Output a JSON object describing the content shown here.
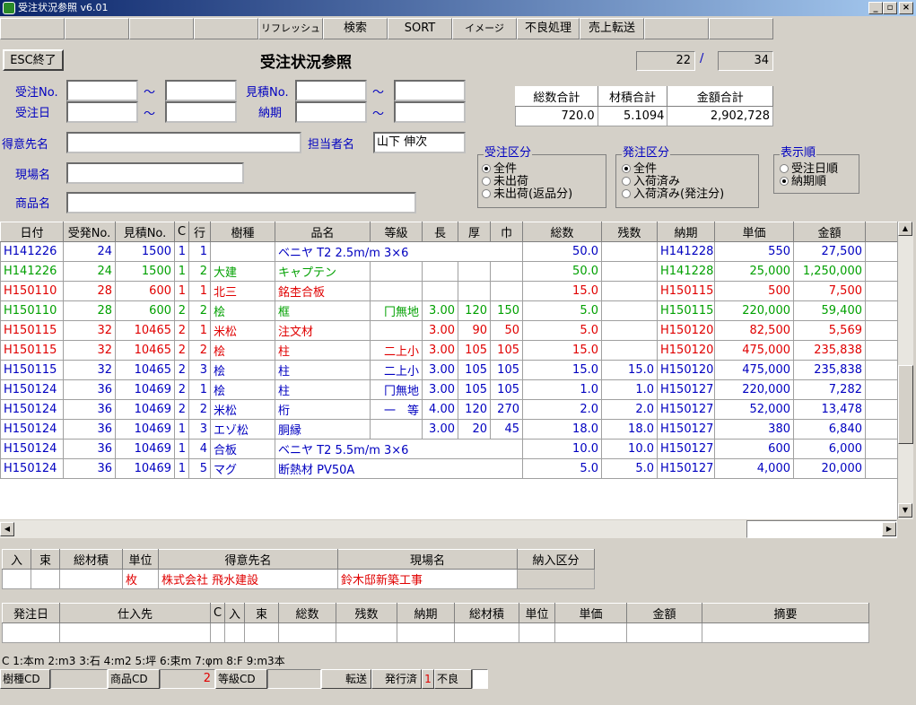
{
  "window": {
    "title": "受注状況参照 v6.01",
    "min": "_",
    "max": "▫",
    "close": "×"
  },
  "toolbar": {
    "buttons": [
      "リフレッシュ",
      "検索",
      "SORT",
      "イメージ",
      "不良処理",
      "売上転送"
    ]
  },
  "header": {
    "esc_label": "ESC終了",
    "page_title": "受注状況参照",
    "current": "22",
    "separator": "/",
    "total": "34"
  },
  "search": {
    "juchu_no_label": "受注No.",
    "juchu_bi_label": "受注日",
    "mitsumori_label": "見積No.",
    "nouki_label": "納期",
    "tilde": "～",
    "tokuisaki_label": "得意先名",
    "genba_label": "現場名",
    "shohin_label": "商品名",
    "tanto_label": "担当者名",
    "tanto_value": "山下 伸次"
  },
  "totals": {
    "headers": [
      "総数合計",
      "材積合計",
      "金額合計"
    ],
    "values": [
      "720.0",
      "5.1094",
      "2,902,728"
    ]
  },
  "juchu_kubun": {
    "legend": "受注区分",
    "options": [
      "全件",
      "未出荷",
      "未出荷(返品分)"
    ],
    "selected": 0
  },
  "hatchu_kubun": {
    "legend": "発注区分",
    "options": [
      "全件",
      "入荷済み",
      "入荷済み(発注分)"
    ],
    "selected": 0
  },
  "hyoji_jun": {
    "legend": "表示順",
    "options": [
      "受注日順",
      "納期順"
    ],
    "selected": 1
  },
  "grid": {
    "headers": [
      "日付",
      "受発No.",
      "見積No.",
      "C",
      "行",
      "樹種",
      "品名",
      "等級",
      "長",
      "厚",
      "巾",
      "総数",
      "残数",
      "納期",
      "単価",
      "金額"
    ],
    "rows": [
      {
        "color": "blu",
        "cells": [
          "H141226",
          "24",
          "1500",
          "1",
          "1",
          "",
          "ベニヤ T2 2.5m/m 3×6",
          "",
          "",
          "",
          "",
          "50.0",
          "",
          "H141228",
          "550",
          "27,500"
        ],
        "span": true
      },
      {
        "color": "grn",
        "cells": [
          "H141226",
          "24",
          "1500",
          "1",
          "2",
          "大建",
          "キャプテン",
          "",
          "",
          "",
          "",
          "50.0",
          "",
          "H141228",
          "25,000",
          "1,250,000"
        ]
      },
      {
        "color": "red",
        "cells": [
          "H150110",
          "28",
          "600",
          "1",
          "1",
          "北三",
          "銘杢合板",
          "",
          "",
          "",
          "",
          "15.0",
          "",
          "H150115",
          "500",
          "7,500"
        ]
      },
      {
        "color": "grn",
        "cells": [
          "H150110",
          "28",
          "600",
          "2",
          "2",
          "桧",
          "框",
          "冂無地",
          "3.00",
          "120",
          "150",
          "5.0",
          "",
          "H150115",
          "220,000",
          "59,400"
        ]
      },
      {
        "color": "red",
        "cells": [
          "H150115",
          "32",
          "10465",
          "2",
          "1",
          "米松",
          "注文材",
          "",
          "3.00",
          "90",
          "50",
          "5.0",
          "",
          "H150120",
          "82,500",
          "5,569"
        ]
      },
      {
        "color": "red",
        "cells": [
          "H150115",
          "32",
          "10465",
          "2",
          "2",
          "桧",
          "柱",
          "二上小",
          "3.00",
          "105",
          "105",
          "15.0",
          "",
          "H150120",
          "475,000",
          "235,838"
        ]
      },
      {
        "color": "blu",
        "cells": [
          "H150115",
          "32",
          "10465",
          "2",
          "3",
          "桧",
          "柱",
          "二上小",
          "3.00",
          "105",
          "105",
          "15.0",
          "15.0",
          "H150120",
          "475,000",
          "235,838"
        ]
      },
      {
        "color": "blu",
        "cells": [
          "H150124",
          "36",
          "10469",
          "2",
          "1",
          "桧",
          "柱",
          "冂無地",
          "3.00",
          "105",
          "105",
          "1.0",
          "1.0",
          "H150127",
          "220,000",
          "7,282"
        ]
      },
      {
        "color": "blu",
        "cells": [
          "H150124",
          "36",
          "10469",
          "2",
          "2",
          "米松",
          "桁",
          "一　等",
          "4.00",
          "120",
          "270",
          "2.0",
          "2.0",
          "H150127",
          "52,000",
          "13,478"
        ]
      },
      {
        "color": "blu",
        "cells": [
          "H150124",
          "36",
          "10469",
          "1",
          "3",
          "エゾ松",
          "胴縁",
          "",
          "3.00",
          "20",
          "45",
          "18.0",
          "18.0",
          "H150127",
          "380",
          "6,840"
        ]
      },
      {
        "color": "blu",
        "cells": [
          "H150124",
          "36",
          "10469",
          "1",
          "4",
          "合板",
          "ベニヤ T2 5.5m/m 3×6",
          "",
          "",
          "",
          "",
          "10.0",
          "10.0",
          "H150127",
          "600",
          "6,000"
        ],
        "span": true
      },
      {
        "color": "blu",
        "cells": [
          "H150124",
          "36",
          "10469",
          "1",
          "5",
          "マグ",
          "断熱材 PV50A",
          "",
          "",
          "",
          "",
          "5.0",
          "5.0",
          "H150127",
          "4,000",
          "20,000"
        ],
        "span": true
      }
    ]
  },
  "detail1": {
    "headers": [
      "入",
      "束",
      "総材積",
      "単位",
      "得意先名",
      "現場名",
      "納入区分"
    ],
    "values": [
      "",
      "",
      "",
      "枚",
      "株式会社 飛水建設",
      "鈴木邸新築工事",
      ""
    ]
  },
  "detail2": {
    "headers": [
      "発注日",
      "仕入先",
      "C",
      "入",
      "束",
      "総数",
      "残数",
      "納期",
      "総材積",
      "単位",
      "単価",
      "金額",
      "摘要"
    ]
  },
  "legend_line": "C 1:本m 2:m3 3:石 4:m2 5:坪 6:束m 7:φm 8:F 9:m3本",
  "status": {
    "jushu_label": "樹種CD",
    "shohin_label": "商品CD",
    "shohin_value": "2",
    "tokyu_label": "等級CD",
    "tenso_label": "転送",
    "hakko_label": "発行済",
    "furyo_num": "1",
    "furyo_label": "不良"
  }
}
